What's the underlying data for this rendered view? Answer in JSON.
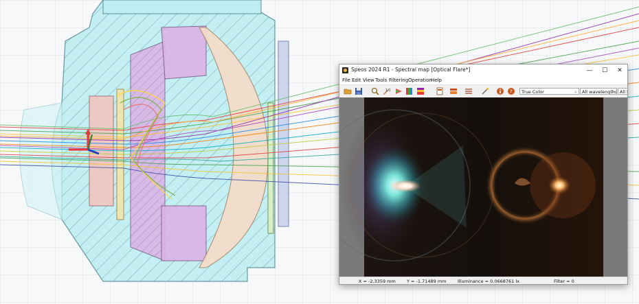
{
  "window": {
    "title": "Speos 2024 R1 - Spectral map [Optical Flare*]",
    "minimize_glyph": "—",
    "maximize_glyph": "☐",
    "close_glyph": "✕"
  },
  "menu": {
    "file": "File",
    "edit": "Edit",
    "view": "View",
    "tools": "Tools",
    "filtering": "Filtering",
    "operation": "Operation",
    "help": "Help"
  },
  "toolbar": {
    "color_mode": "True Color",
    "wavelengths": "All wavelengths",
    "layers": "All la"
  },
  "status": {
    "x": "X = -2.3359 mm",
    "y": "Y = -1.71489 mm",
    "illuminance": "Illuminance = 0.0668761 lx",
    "filter": "Filter = 0"
  },
  "colors": {
    "housing": "#bfeef2",
    "lens_pink": "#f2c6c2",
    "lens_purple": "#dcb2e6",
    "lens_peach": "#f6dcc8",
    "viewport_bg": "#7a7a7a",
    "flare_bg": "#1a0f0a"
  },
  "icons": [
    "open-icon",
    "save-icon",
    "zoom-icon",
    "tool-icon",
    "spectrum-icon",
    "color-icon",
    "palette-icon",
    "document-icon",
    "layers-icon",
    "list-icon",
    "wand-icon",
    "info-icon",
    "help-icon"
  ]
}
